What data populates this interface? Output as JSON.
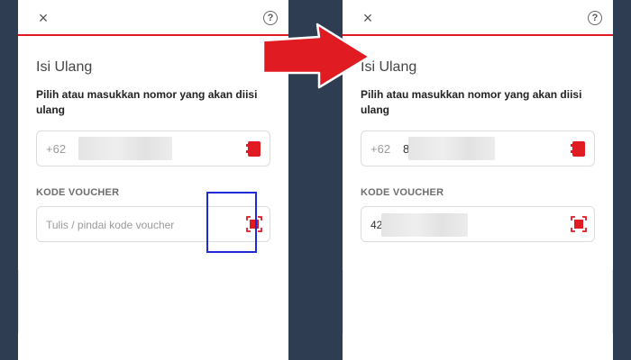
{
  "left_screen": {
    "close_glyph": "×",
    "help_glyph": "?",
    "title": "Isi Ulang",
    "subtitle": "Pilih atau masukkan nomor yang akan diisi ulang",
    "phone": {
      "prefix": "+62",
      "value": "8"
    },
    "voucher_label": "KODE VOUCHER",
    "voucher_placeholder": "Tulis / pindai kode voucher",
    "voucher_value": ""
  },
  "right_screen": {
    "close_glyph": "×",
    "help_glyph": "?",
    "title": "Isi Ulang",
    "subtitle": "Pilih atau masukkan nomor yang akan diisi ulang",
    "phone": {
      "prefix": "+62",
      "value": "85"
    },
    "voucher_label": "KODE VOUCHER",
    "voucher_value": "42"
  },
  "icons": {
    "contact": "contact-book-icon",
    "scan": "scan-barcode-icon",
    "arrow": "right-arrow-icon"
  },
  "colors": {
    "accent": "#e01b22",
    "highlight": "#1f2bd6",
    "backdrop": "#2f3d52"
  }
}
